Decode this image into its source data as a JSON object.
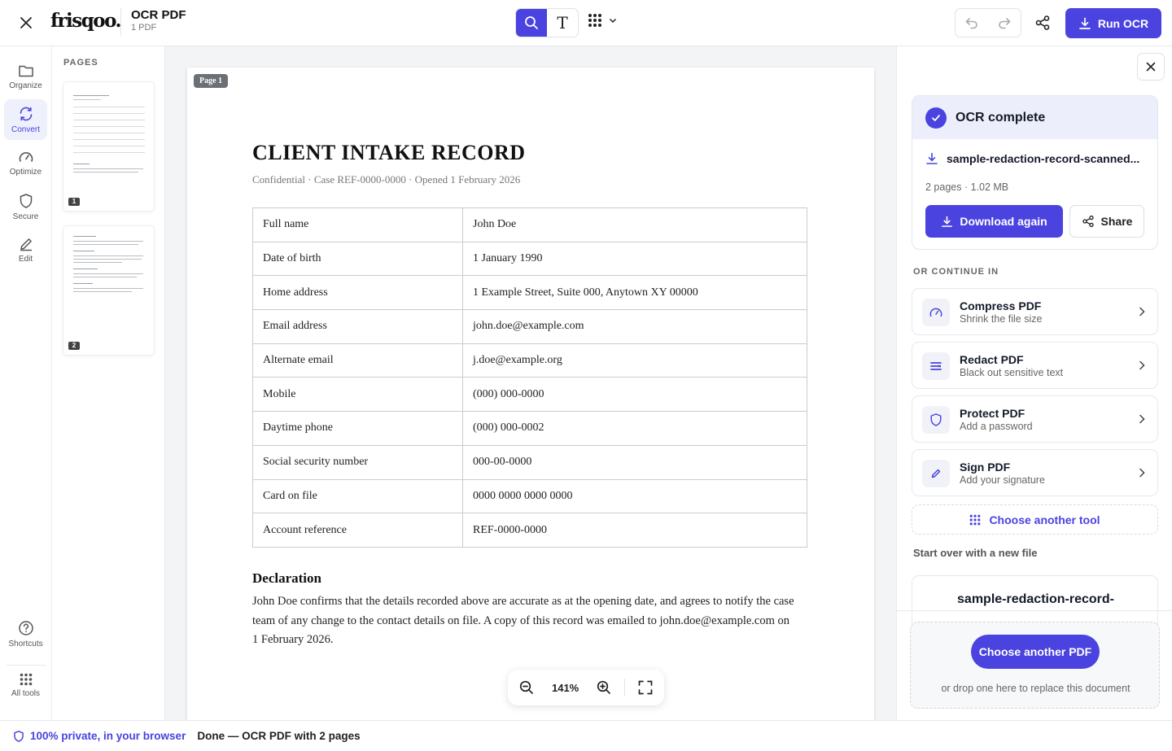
{
  "header": {
    "logo": "frisqoo.",
    "app_title": "OCR PDF",
    "app_subtitle": "1 PDF",
    "run_label": "Run OCR"
  },
  "rail": {
    "items": [
      {
        "label": "Organize",
        "icon": "folder-icon"
      },
      {
        "label": "Convert",
        "icon": "convert-icon",
        "active": true
      },
      {
        "label": "Optimize",
        "icon": "gauge-icon"
      },
      {
        "label": "Secure",
        "icon": "shield-icon"
      },
      {
        "label": "Edit",
        "icon": "pencil-icon"
      }
    ],
    "shortcuts_label": "Shortcuts",
    "all_tools_label": "All tools"
  },
  "pages_panel": {
    "title": "PAGES",
    "thumbs": [
      {
        "num": "1"
      },
      {
        "num": "2"
      }
    ]
  },
  "document": {
    "page_chip": "Page 1",
    "title": "CLIENT INTAKE RECORD",
    "meta": "Confidential  ·  Case REF-0000-0000  ·  Opened 1 February 2026",
    "rows": [
      {
        "k": "Full name",
        "v": "John Doe"
      },
      {
        "k": "Date of birth",
        "v": "1 January 1990"
      },
      {
        "k": "Home address",
        "v": "1 Example Street, Suite 000, Anytown XY 00000"
      },
      {
        "k": "Email address",
        "v": "john.doe@example.com"
      },
      {
        "k": "Alternate email",
        "v": "j.doe@example.org"
      },
      {
        "k": "Mobile",
        "v": "(000) 000-0000"
      },
      {
        "k": "Daytime phone",
        "v": "(000) 000-0002"
      },
      {
        "k": "Social security number",
        "v": "000-00-0000"
      },
      {
        "k": "Card on file",
        "v": "0000 0000 0000 0000"
      },
      {
        "k": "Account reference",
        "v": "REF-0000-0000"
      }
    ],
    "declaration_heading": "Declaration",
    "declaration_text": "John Doe confirms that the details recorded above are accurate as at the opening date, and agrees to notify the case team of any change to the contact details on file. A copy of this record was emailed to john.doe@example.com on 1 February 2026."
  },
  "zoom": {
    "value": "141%"
  },
  "result": {
    "title": "OCR complete",
    "file_name": "sample-redaction-record-scanned...",
    "file_meta": "2 pages · 1.02 MB",
    "download_label": "Download again",
    "share_label": "Share"
  },
  "continue": {
    "label": "OR CONTINUE IN",
    "tools": [
      {
        "name": "Compress PDF",
        "desc": "Shrink the file size",
        "icon": "gauge-icon"
      },
      {
        "name": "Redact PDF",
        "desc": "Black out sensitive text",
        "icon": "redact-icon"
      },
      {
        "name": "Protect PDF",
        "desc": "Add a password",
        "icon": "shield-icon"
      },
      {
        "name": "Sign PDF",
        "desc": "Add your signature",
        "icon": "pen-icon"
      }
    ],
    "choose_tool_label": "Choose another tool",
    "start_over_label": "Start over with a new file",
    "recent_file": "sample-redaction-record-",
    "choose_pdf_label": "Choose another PDF",
    "drop_hint": "or drop one here to replace this document"
  },
  "status": {
    "private_label": "100% private, in your browser",
    "status_text": "Done — OCR PDF with 2 pages"
  },
  "colors": {
    "accent": "#4a43e0",
    "accent_soft": "#eceefb"
  }
}
